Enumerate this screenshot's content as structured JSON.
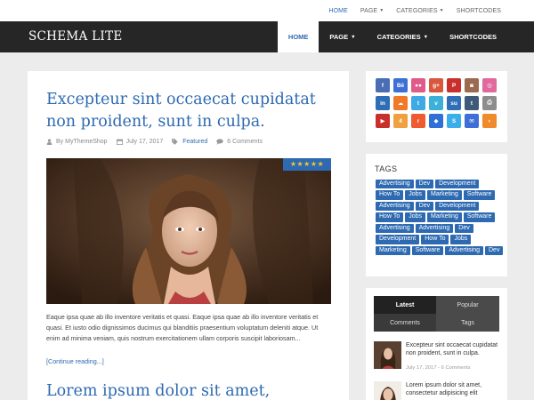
{
  "topnav": {
    "items": [
      {
        "label": "HOME",
        "active": true
      },
      {
        "label": "PAGE",
        "caret": true
      },
      {
        "label": "CATEGORIES",
        "caret": true
      },
      {
        "label": "SHORTCODES"
      }
    ]
  },
  "header": {
    "logo": "SCHEMA LITE",
    "nav": [
      {
        "label": "HOME",
        "active": true
      },
      {
        "label": "PAGE",
        "caret": true
      },
      {
        "label": "CATEGORIES",
        "caret": true
      },
      {
        "label": "SHORTCODES"
      }
    ]
  },
  "post": {
    "title": "Excepteur sint occaecat cupidatat non proident, sunt in culpa.",
    "author": "By MyThemeShop",
    "date": "July 17, 2017",
    "category": "Featured",
    "comments": "6 Comments",
    "rating_stars": "★★★★★",
    "excerpt": "Eaque ipsa quae ab illo inventore veritatis et quasi. Eaque ipsa quae ab illo inventore veritatis et quasi. Et iusto odio dignissimos ducimus qui blanditiis praesentium voluptatum deleniti atque. Ut enim ad minima veniam, quis nostrum exercitationem ullam corporis suscipit laboriosam...",
    "readmore": "[Continue reading...]"
  },
  "post2": {
    "title": "Lorem ipsum dolor sit amet,"
  },
  "colors": {
    "accent": "#2e6ab1",
    "header_bg": "#262626",
    "page_bg": "#ececec"
  },
  "social": [
    {
      "icon": "facebook-icon",
      "glyph": "f",
      "color": "#4a6eb3"
    },
    {
      "icon": "behance-icon",
      "glyph": "Bē",
      "color": "#3d6fd6"
    },
    {
      "icon": "flickr-icon",
      "glyph": "●●",
      "color": "#e05a8a"
    },
    {
      "icon": "google-plus-icon",
      "glyph": "g+",
      "color": "#d9573d"
    },
    {
      "icon": "pinterest-icon",
      "glyph": "P",
      "color": "#c9302c"
    },
    {
      "icon": "instagram-icon",
      "glyph": "◙",
      "color": "#9b6a4f"
    },
    {
      "icon": "dribbble-icon",
      "glyph": "◎",
      "color": "#e06a9d"
    },
    {
      "icon": "linkedin-icon",
      "glyph": "in",
      "color": "#2e6eb5"
    },
    {
      "icon": "soundcloud-icon",
      "glyph": "☁",
      "color": "#f07a2a"
    },
    {
      "icon": "twitter-icon",
      "glyph": "t",
      "color": "#3fa9e8"
    },
    {
      "icon": "vimeo-icon",
      "glyph": "v",
      "color": "#3cb0d8"
    },
    {
      "icon": "stumbleupon-icon",
      "glyph": "su",
      "color": "#2f6fb8"
    },
    {
      "icon": "tumblr-icon",
      "glyph": "t",
      "color": "#3d5a7a"
    },
    {
      "icon": "print-icon",
      "glyph": "⎙",
      "color": "#8d8d8d"
    },
    {
      "icon": "youtube-icon",
      "glyph": "▶",
      "color": "#c9302c"
    },
    {
      "icon": "foursquare-icon",
      "glyph": "4",
      "color": "#f0a040"
    },
    {
      "icon": "reddit-icon",
      "glyph": "r",
      "color": "#f05a30"
    },
    {
      "icon": "dropbox-icon",
      "glyph": "◆",
      "color": "#2f6fd6"
    },
    {
      "icon": "skype-icon",
      "glyph": "S",
      "color": "#3aaee8"
    },
    {
      "icon": "email-icon",
      "glyph": "✉",
      "color": "#3d6fd6"
    },
    {
      "icon": "rss-icon",
      "glyph": "◗",
      "color": "#f08a2a"
    }
  ],
  "tags_widget": {
    "title": "TAGS",
    "tags": [
      "Advertising",
      "Dev",
      "Development",
      "How To",
      "Jobs",
      "Marketing",
      "Software",
      "Advertising",
      "Dev",
      "Development",
      "How To",
      "Jobs",
      "Marketing",
      "Software",
      "Advertising",
      "Advertising",
      "Dev",
      "Development",
      "How To",
      "Jobs",
      "Marketing",
      "Software",
      "Advertising",
      "Dev"
    ]
  },
  "tabs_widget": {
    "tabs": [
      {
        "label": "Latest",
        "active": true
      },
      {
        "label": "Popular"
      },
      {
        "label": "Comments"
      },
      {
        "label": "Tags"
      }
    ],
    "posts": [
      {
        "title": "Excepteur sint occaecat cupidatat non proident, sunt in culpa.",
        "meta": "July 17, 2017 - 6 Comments"
      },
      {
        "title": "Lorem ipsum dolor sit amet, consectetur adipisicing elit",
        "meta": ""
      }
    ]
  }
}
